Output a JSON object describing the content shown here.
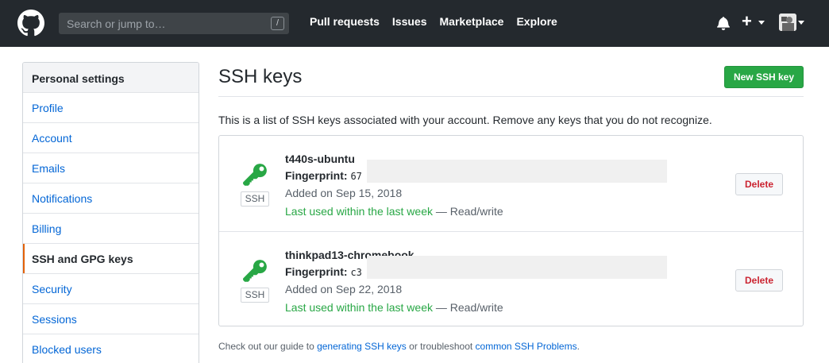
{
  "header": {
    "search_placeholder": "Search or jump to…",
    "search_shortcut": "/",
    "nav": [
      "Pull requests",
      "Issues",
      "Marketplace",
      "Explore"
    ],
    "plus": "+"
  },
  "sidebar": {
    "heading": "Personal settings",
    "items": [
      {
        "label": "Profile"
      },
      {
        "label": "Account"
      },
      {
        "label": "Emails"
      },
      {
        "label": "Notifications"
      },
      {
        "label": "Billing"
      },
      {
        "label": "SSH and GPG keys",
        "selected": true
      },
      {
        "label": "Security"
      },
      {
        "label": "Sessions"
      },
      {
        "label": "Blocked users"
      }
    ]
  },
  "main": {
    "title": "SSH keys",
    "new_button": "New SSH key",
    "description": "This is a list of SSH keys associated with your account. Remove any keys that you do not recognize.",
    "keys": [
      {
        "name": "t440s-ubuntu",
        "fingerprint_label": "Fingerprint:",
        "fingerprint_value": "67",
        "added": "Added on Sep 15, 2018",
        "last_used": "Last used within the last week",
        "access": " — Read/write",
        "badge": "SSH",
        "delete": "Delete"
      },
      {
        "name": "thinkpad13-chromebook",
        "fingerprint_label": "Fingerprint:",
        "fingerprint_value": "c3",
        "added": "Added on Sep 22, 2018",
        "last_used": "Last used within the last week",
        "access": " — Read/write",
        "badge": "SSH",
        "delete": "Delete"
      }
    ],
    "footer": {
      "pre": "Check out our guide to ",
      "link1": "generating SSH keys",
      "mid": " or troubleshoot ",
      "link2": "common SSH Problems",
      "post": "."
    }
  },
  "colors": {
    "header_bg": "#24292e",
    "link": "#0366d6",
    "green": "#28a745",
    "danger": "#cb2431",
    "selected_accent": "#e36209"
  }
}
